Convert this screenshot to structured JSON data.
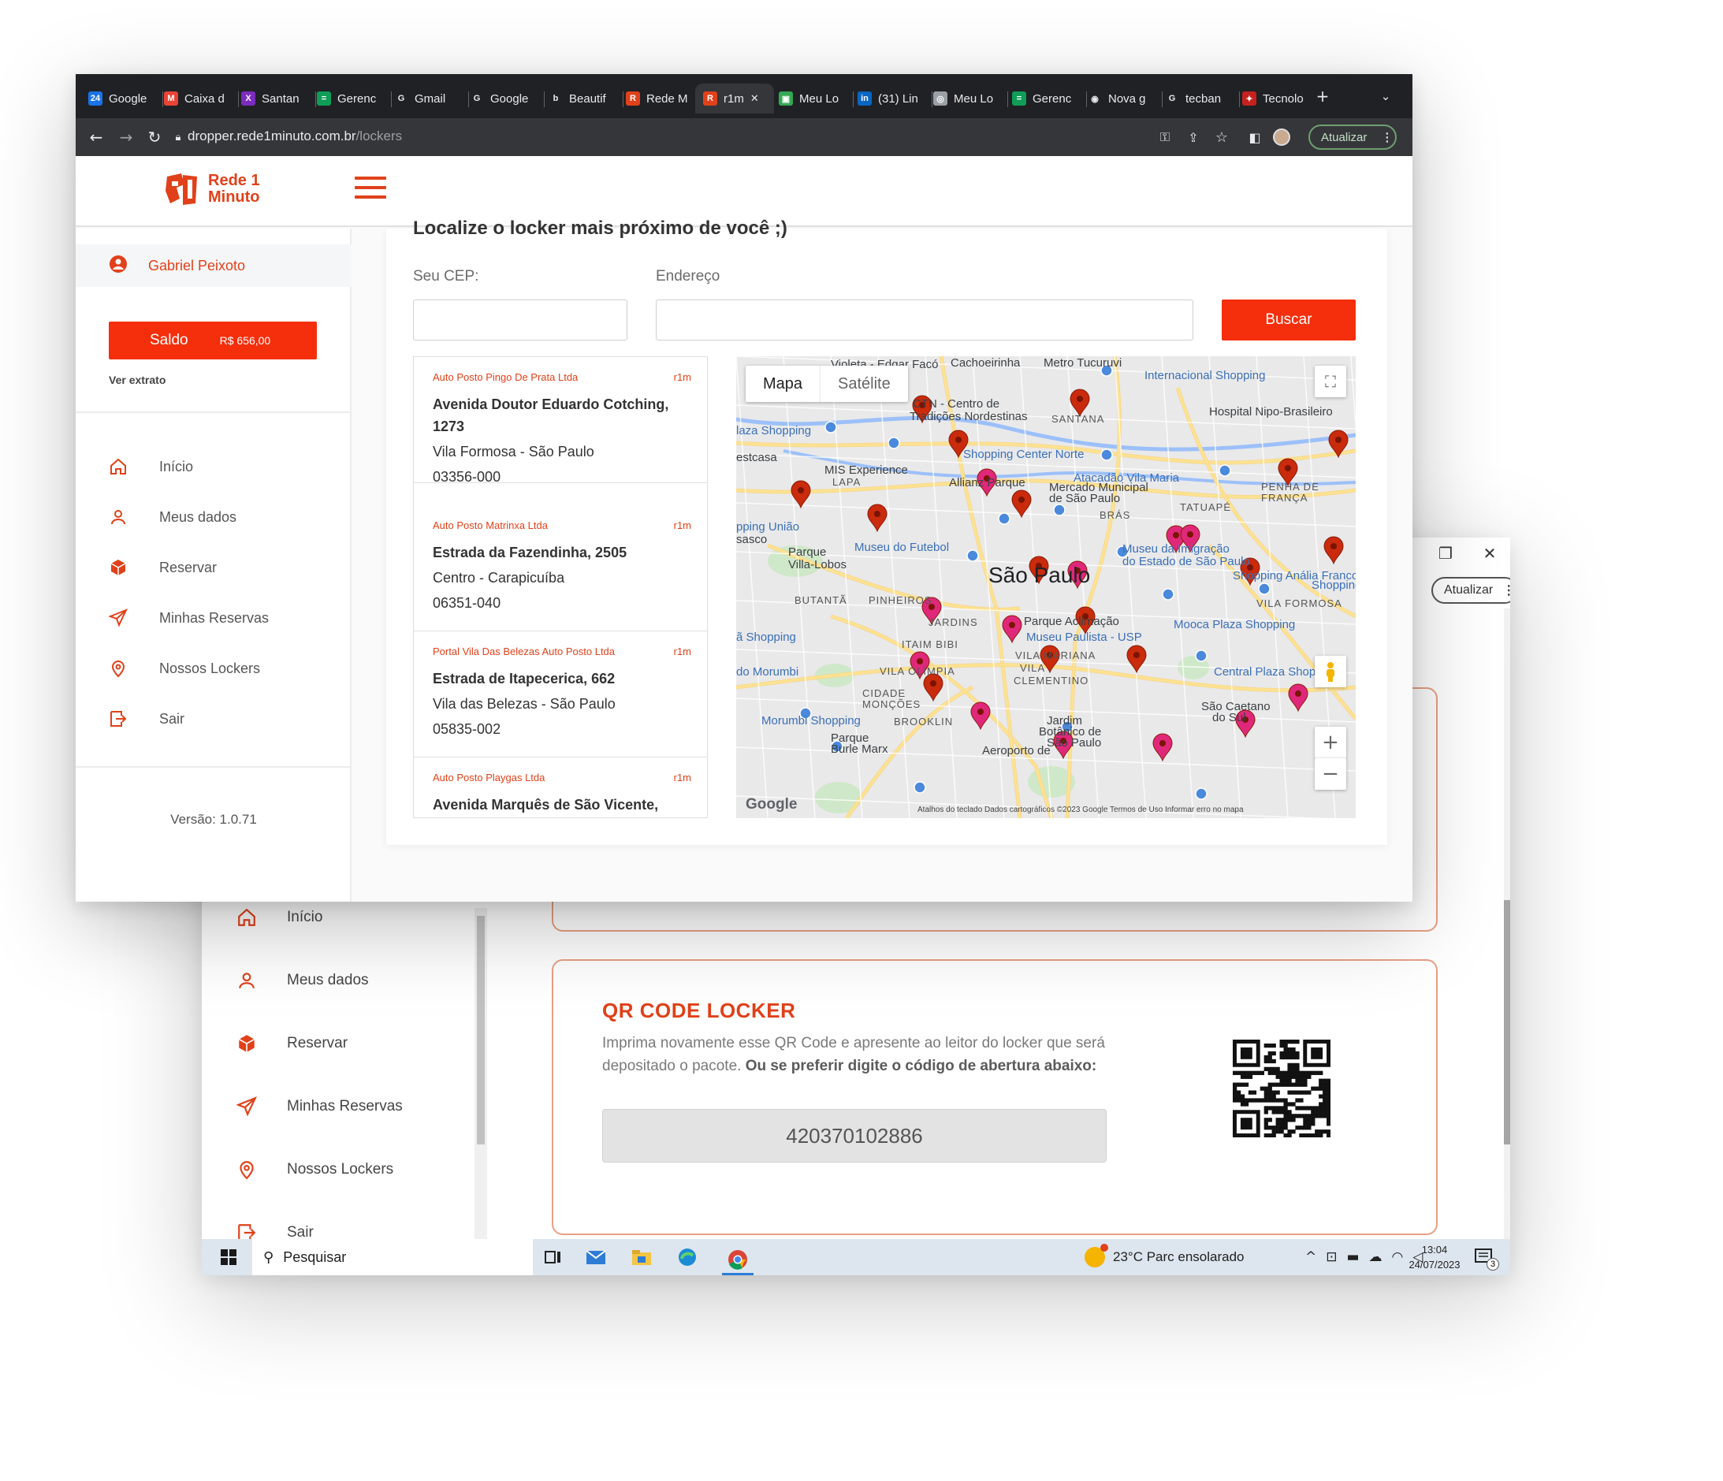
{
  "front_browser": {
    "tabs": [
      {
        "label": "Google",
        "color": "#1a73e8",
        "glyph": "24"
      },
      {
        "label": "Caixa d",
        "color": "#ea4335",
        "glyph": "M"
      },
      {
        "label": "Santan",
        "color": "#7b2cbf",
        "glyph": "X"
      },
      {
        "label": "Gerenc",
        "color": "#0f9d58",
        "glyph": "="
      },
      {
        "label": "Gmail",
        "color": "#ffffff",
        "glyph": "G"
      },
      {
        "label": "Google",
        "color": "#ffffff",
        "glyph": "G"
      },
      {
        "label": "Beautif",
        "color": "#ffffff",
        "glyph": "b"
      },
      {
        "label": "Rede M",
        "color": "#e0411a",
        "glyph": "R"
      },
      {
        "label": "r1m",
        "color": "#e0411a",
        "glyph": "R"
      },
      {
        "label": "Meu Lo",
        "color": "#34a853",
        "glyph": "▣"
      },
      {
        "label": "(31) Lin",
        "color": "#0a66c2",
        "glyph": "in"
      },
      {
        "label": "Meu Lo",
        "color": "#9aa0a6",
        "glyph": "◎"
      },
      {
        "label": "Gerenc",
        "color": "#0f9d58",
        "glyph": "="
      },
      {
        "label": "Nova g",
        "color": "#ffffff",
        "glyph": "◉"
      },
      {
        "label": "tecban",
        "color": "#ffffff",
        "glyph": "G"
      },
      {
        "label": "Tecnolo",
        "color": "#c5221f",
        "glyph": "✦"
      }
    ],
    "url_host": "dropper.rede1minuto.com.br",
    "url_path": "/lockers",
    "update_label": "Atualizar"
  },
  "brand": {
    "name_line1": "Rede 1",
    "name_line2": "Minuto",
    "accent": "#e0411a",
    "button_color": "#f52e0b"
  },
  "sidebar": {
    "user_name": "Gabriel Peixoto",
    "saldo_label": "Saldo",
    "saldo_value": "R$ 656,00",
    "extrato_label": "Ver extrato",
    "items": [
      {
        "label": "Início",
        "icon": "home-icon"
      },
      {
        "label": "Meus dados",
        "icon": "user-icon"
      },
      {
        "label": "Reservar",
        "icon": "box-icon"
      },
      {
        "label": "Minhas Reservas",
        "icon": "send-icon"
      },
      {
        "label": "Nossos Lockers",
        "icon": "location-pin-icon"
      },
      {
        "label": "Sair",
        "icon": "logout-icon"
      }
    ],
    "version": "Versão: 1.0.71"
  },
  "main": {
    "title": "Localize o locker mais próximo de você ;)",
    "cep_label": "Seu CEP:",
    "cep_value": "",
    "address_label": "Endereço",
    "address_value": "",
    "search_button": "Buscar",
    "lockers": [
      {
        "name": "Auto Posto Pingo De Prata Ltda",
        "tag": "r1m",
        "street": "Avenida Doutor Eduardo Cotching, 1273",
        "district": "Vila Formosa - São Paulo",
        "cep": "03356-000"
      },
      {
        "name": "Auto Posto Matrinxa Ltda",
        "tag": "r1m",
        "street": "Estrada da Fazendinha, 2505",
        "district": "Centro - Carapicuíba",
        "cep": "06351-040"
      },
      {
        "name": "Portal Vila Das Belezas Auto Posto Ltda",
        "tag": "r1m",
        "street": "Estrada de Itapecerica, 662",
        "district": "Vila das Belezas - São Paulo",
        "cep": "05835-002"
      },
      {
        "name": "Auto Posto Playgas Ltda",
        "tag": "r1m",
        "street": "Avenida Marquês de São Vicente,",
        "district": "",
        "cep": ""
      }
    ]
  },
  "map": {
    "tab_map": "Mapa",
    "tab_satellite": "Satélite",
    "google_logo": "Google",
    "attribution": "Atalhos do teclado   Dados cartográficos ©2023 Google   Termos de Uso   Informar erro no mapa",
    "labels": [
      {
        "text": "Violeta - Edgar Facó",
        "kind": "normal"
      },
      {
        "text": "Cachoeirinha",
        "kind": "normal"
      },
      {
        "text": "Metro Tucuruvi",
        "kind": "normal"
      },
      {
        "text": "Internacional Shopping",
        "kind": "blue"
      },
      {
        "text": "Hospital Nipo-Brasileiro",
        "kind": "normal"
      },
      {
        "text": "CTN - Centro de",
        "kind": "normal"
      },
      {
        "text": "Tradições Nordestinas",
        "kind": "normal"
      },
      {
        "text": "SANTANA",
        "kind": "caps"
      },
      {
        "text": "laza Shopping",
        "kind": "blue"
      },
      {
        "text": "Shopping Center Norte",
        "kind": "blue"
      },
      {
        "text": "estcasa",
        "kind": "normal"
      },
      {
        "text": "MIS Experience",
        "kind": "normal"
      },
      {
        "text": "Atacadão Vila Maria",
        "kind": "blue"
      },
      {
        "text": "LAPA",
        "kind": "caps"
      },
      {
        "text": "Allianz Parque",
        "kind": "normal"
      },
      {
        "text": "Mercado Municipal",
        "kind": "normal"
      },
      {
        "text": "de São Paulo",
        "kind": "normal"
      },
      {
        "text": "PENHA DE",
        "kind": "caps"
      },
      {
        "text": "FRANÇA",
        "kind": "caps"
      },
      {
        "text": "TATUAPÉ",
        "kind": "caps"
      },
      {
        "text": "BRÁS",
        "kind": "caps"
      },
      {
        "text": "pping União",
        "kind": "blue"
      },
      {
        "text": "sasco",
        "kind": "normal"
      },
      {
        "text": "Museu do Futebol",
        "kind": "blue"
      },
      {
        "text": "Museu da Imigração",
        "kind": "blue"
      },
      {
        "text": "do Estado de São Paulo",
        "kind": "blue"
      },
      {
        "text": "Parque",
        "kind": "normal"
      },
      {
        "text": "Villa-Lobos",
        "kind": "normal"
      },
      {
        "text": "São Paulo",
        "kind": "big"
      },
      {
        "text": "Shopping Anália Franco",
        "kind": "blue"
      },
      {
        "text": "Shopping Aricanduva",
        "kind": "blue"
      },
      {
        "text": "BUTANTÃ",
        "kind": "caps"
      },
      {
        "text": "PINHEIROS",
        "kind": "caps"
      },
      {
        "text": "VILA FORMOSA",
        "kind": "caps"
      },
      {
        "text": "JARDINS",
        "kind": "caps"
      },
      {
        "text": "Parque Aclimação",
        "kind": "normal"
      },
      {
        "text": "Mooca Plaza Shopping",
        "kind": "blue"
      },
      {
        "text": "ã Shopping",
        "kind": "blue"
      },
      {
        "text": "ITAIM BIBI",
        "kind": "caps"
      },
      {
        "text": "Museu Paulista - USP",
        "kind": "blue"
      },
      {
        "text": "VILA MARIANA",
        "kind": "caps"
      },
      {
        "text": "do Morumbi",
        "kind": "blue"
      },
      {
        "text": "VILA OLÍMPIA",
        "kind": "caps"
      },
      {
        "text": "VILA",
        "kind": "caps"
      },
      {
        "text": "CLEMENTINO",
        "kind": "caps"
      },
      {
        "text": "Central Plaza Shopping",
        "kind": "blue"
      },
      {
        "text": "CIDADE",
        "kind": "caps"
      },
      {
        "text": "MONÇÕES",
        "kind": "caps"
      },
      {
        "text": "Morumbi Shopping",
        "kind": "blue"
      },
      {
        "text": "BROOKLIN",
        "kind": "caps"
      },
      {
        "text": "Jardim",
        "kind": "normal"
      },
      {
        "text": "Botânico de",
        "kind": "normal"
      },
      {
        "text": "São Paulo",
        "kind": "normal"
      },
      {
        "text": "São Caetano",
        "kind": "normal"
      },
      {
        "text": "do Sul",
        "kind": "normal"
      },
      {
        "text": "Parque",
        "kind": "normal"
      },
      {
        "text": "Burle Marx",
        "kind": "normal"
      },
      {
        "text": "Aeroporto de",
        "kind": "normal"
      }
    ],
    "pins_red": 15,
    "pins_pink": 12
  },
  "back_window": {
    "update_label": "Atualizar",
    "sidebar_items": [
      {
        "label": "Início",
        "icon": "home-icon"
      },
      {
        "label": "Meus dados",
        "icon": "user-icon"
      },
      {
        "label": "Reservar",
        "icon": "box-icon"
      },
      {
        "label": "Minhas Reservas",
        "icon": "send-icon"
      },
      {
        "label": "Nossos Lockers",
        "icon": "location-pin-icon"
      },
      {
        "label": "Sair",
        "icon": "logout-icon"
      }
    ],
    "qr_title": "QR CODE LOCKER",
    "qr_text_plain": "Imprima novamente esse QR Code e apresente ao leitor do locker que será depositado o pacote.",
    "qr_text_bold": "Ou se preferir digite o código de abertura abaixo:",
    "qr_code_value": "420370102886"
  },
  "taskbar": {
    "search_label": "Pesquisar",
    "weather": "23°C  Parc ensolarado",
    "time": "13:04",
    "date": "24/07/2023",
    "notification_count": "3"
  }
}
